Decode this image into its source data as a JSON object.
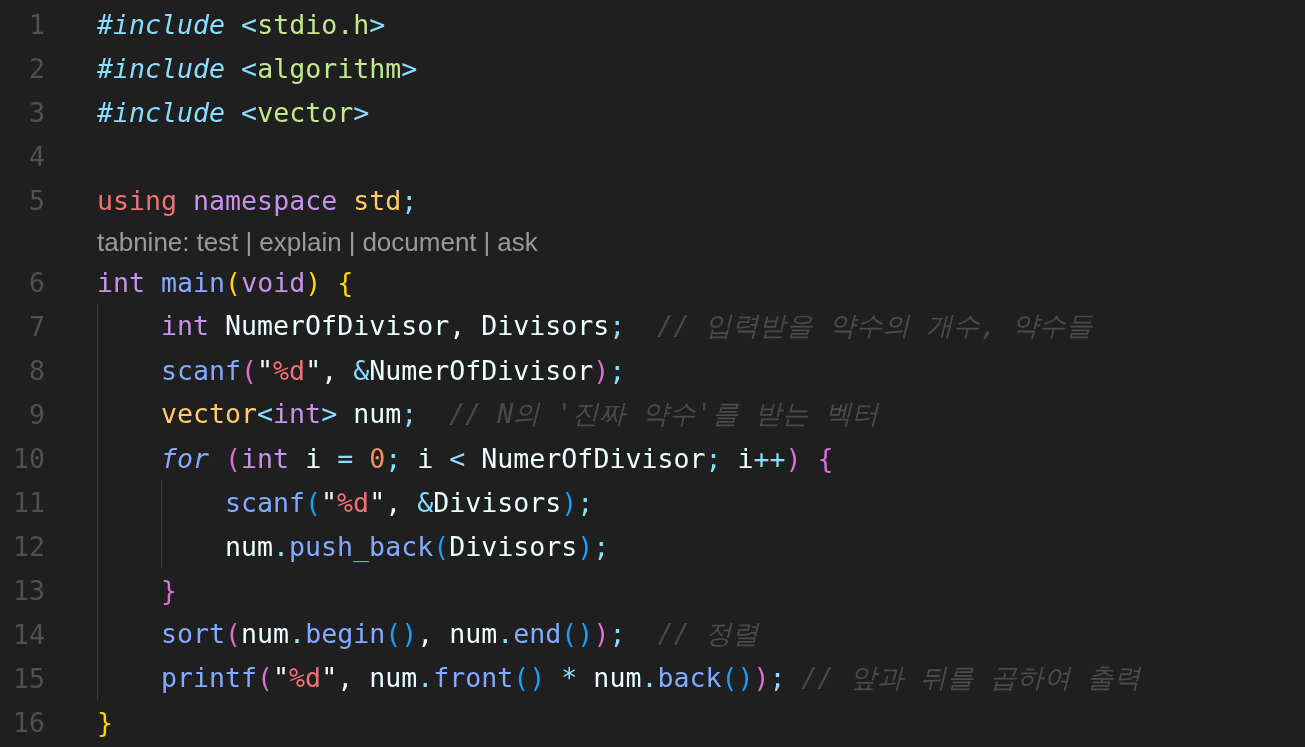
{
  "editor": {
    "lines": [
      {
        "kind": "code",
        "number": "1",
        "tokens": [
          {
            "text": "#include",
            "kind": "directive"
          },
          {
            "text": " <",
            "kind": "punct"
          },
          {
            "text": "stdio.h",
            "kind": "header"
          },
          {
            "text": ">",
            "kind": "punct"
          }
        ]
      },
      {
        "kind": "code",
        "number": "2",
        "tokens": [
          {
            "text": "#include",
            "kind": "directive"
          },
          {
            "text": " <",
            "kind": "punct"
          },
          {
            "text": "algorithm",
            "kind": "header"
          },
          {
            "text": ">",
            "kind": "punct"
          }
        ]
      },
      {
        "kind": "code",
        "number": "3",
        "tokens": [
          {
            "text": "#include",
            "kind": "directive"
          },
          {
            "text": " <",
            "kind": "punct"
          },
          {
            "text": "vector",
            "kind": "header"
          },
          {
            "text": ">",
            "kind": "punct"
          }
        ]
      },
      {
        "kind": "code",
        "number": "4"
      },
      {
        "kind": "code",
        "number": "5",
        "tokens": [
          {
            "text": "using",
            "kind": "keyword"
          },
          {
            "text": " namespace",
            "kind": "storage"
          },
          {
            "text": " std",
            "kind": "type"
          },
          {
            "text": ";",
            "kind": "punct"
          }
        ]
      },
      {
        "kind": "codelens",
        "prefix": "tabnine:",
        "separator": "|",
        "actions": [
          "test",
          "explain",
          "document",
          "ask"
        ]
      },
      {
        "kind": "code",
        "number": "6",
        "tokens": [
          {
            "text": "int",
            "kind": "storage"
          },
          {
            "text": " main",
            "kind": "function"
          },
          {
            "text": "(",
            "kind": "bracket1"
          },
          {
            "text": "void",
            "kind": "storage"
          },
          {
            "text": ")",
            "kind": "bracket1"
          },
          {
            "text": " {",
            "kind": "bracket1"
          }
        ],
        "children": [
          {
            "kind": "code",
            "number": "7",
            "tokens": [
              {
                "text": "int",
                "kind": "storage"
              },
              {
                "text": " NumerOfDivisor, Divisors",
                "kind": "plain"
              },
              {
                "text": ";",
                "kind": "punct"
              },
              {
                "text": "  // 입력받을 약수의 개수, 약수들",
                "kind": "comment"
              }
            ]
          },
          {
            "kind": "code",
            "number": "8",
            "tokens": [
              {
                "text": "scanf",
                "kind": "function"
              },
              {
                "text": "(",
                "kind": "bracket2"
              },
              {
                "text": "\"",
                "kind": "string"
              },
              {
                "text": "%d",
                "kind": "format"
              },
              {
                "text": "\"",
                "kind": "string"
              },
              {
                "text": ", ",
                "kind": "plain"
              },
              {
                "text": "&",
                "kind": "punct"
              },
              {
                "text": "NumerOfDivisor",
                "kind": "plain"
              },
              {
                "text": ")",
                "kind": "bracket2"
              },
              {
                "text": ";",
                "kind": "punct"
              }
            ]
          },
          {
            "kind": "code",
            "number": "9",
            "tokens": [
              {
                "text": "vector",
                "kind": "type"
              },
              {
                "text": "<",
                "kind": "punct"
              },
              {
                "text": "int",
                "kind": "storage"
              },
              {
                "text": ">",
                "kind": "punct"
              },
              {
                "text": " num",
                "kind": "plain"
              },
              {
                "text": ";",
                "kind": "punct"
              },
              {
                "text": "  // N의 '진짜 약수'를 받는 벡터",
                "kind": "comment"
              }
            ]
          },
          {
            "kind": "code",
            "number": "10",
            "tokens": [
              {
                "text": "for",
                "kind": "control"
              },
              {
                "text": " (",
                "kind": "bracket2"
              },
              {
                "text": "int",
                "kind": "storage"
              },
              {
                "text": " i ",
                "kind": "plain"
              },
              {
                "text": "=",
                "kind": "punct"
              },
              {
                "text": " 0",
                "kind": "number"
              },
              {
                "text": ";",
                "kind": "punct"
              },
              {
                "text": " i ",
                "kind": "plain"
              },
              {
                "text": "<",
                "kind": "punct"
              },
              {
                "text": " NumerOfDivisor",
                "kind": "plain"
              },
              {
                "text": ";",
                "kind": "punct"
              },
              {
                "text": " i",
                "kind": "plain"
              },
              {
                "text": "++",
                "kind": "punct"
              },
              {
                "text": ")",
                "kind": "bracket2"
              },
              {
                "text": " {",
                "kind": "bracket2"
              }
            ],
            "children": [
              {
                "kind": "code",
                "number": "11",
                "tokens": [
                  {
                    "text": "scanf",
                    "kind": "function"
                  },
                  {
                    "text": "(",
                    "kind": "bracket3"
                  },
                  {
                    "text": "\"",
                    "kind": "string"
                  },
                  {
                    "text": "%d",
                    "kind": "format"
                  },
                  {
                    "text": "\"",
                    "kind": "string"
                  },
                  {
                    "text": ", ",
                    "kind": "plain"
                  },
                  {
                    "text": "&",
                    "kind": "punct"
                  },
                  {
                    "text": "Divisors",
                    "kind": "plain"
                  },
                  {
                    "text": ")",
                    "kind": "bracket3"
                  },
                  {
                    "text": ";",
                    "kind": "punct"
                  }
                ]
              },
              {
                "kind": "code",
                "number": "12",
                "tokens": [
                  {
                    "text": "num",
                    "kind": "plain"
                  },
                  {
                    "text": ".",
                    "kind": "punct"
                  },
                  {
                    "text": "push_back",
                    "kind": "function"
                  },
                  {
                    "text": "(",
                    "kind": "bracket3"
                  },
                  {
                    "text": "Divisors",
                    "kind": "plain"
                  },
                  {
                    "text": ")",
                    "kind": "bracket3"
                  },
                  {
                    "text": ";",
                    "kind": "punct"
                  }
                ]
              }
            ]
          },
          {
            "kind": "code",
            "number": "13",
            "tokens": [
              {
                "text": "}",
                "kind": "bracket2"
              }
            ]
          },
          {
            "kind": "code",
            "number": "14",
            "tokens": [
              {
                "text": "sort",
                "kind": "function"
              },
              {
                "text": "(",
                "kind": "bracket2"
              },
              {
                "text": "num",
                "kind": "plain"
              },
              {
                "text": ".",
                "kind": "punct"
              },
              {
                "text": "begin",
                "kind": "function"
              },
              {
                "text": "()",
                "kind": "bracket3"
              },
              {
                "text": ", num",
                "kind": "plain"
              },
              {
                "text": ".",
                "kind": "punct"
              },
              {
                "text": "end",
                "kind": "function"
              },
              {
                "text": "()",
                "kind": "bracket3"
              },
              {
                "text": ")",
                "kind": "bracket2"
              },
              {
                "text": ";",
                "kind": "punct"
              },
              {
                "text": "  // 정렬",
                "kind": "comment"
              }
            ]
          },
          {
            "kind": "code",
            "number": "15",
            "tokens": [
              {
                "text": "printf",
                "kind": "function"
              },
              {
                "text": "(",
                "kind": "bracket2"
              },
              {
                "text": "\"",
                "kind": "string"
              },
              {
                "text": "%d",
                "kind": "format"
              },
              {
                "text": "\"",
                "kind": "string"
              },
              {
                "text": ", num",
                "kind": "plain"
              },
              {
                "text": ".",
                "kind": "punct"
              },
              {
                "text": "front",
                "kind": "function"
              },
              {
                "text": "()",
                "kind": "bracket3"
              },
              {
                "text": " *",
                "kind": "punct"
              },
              {
                "text": " num",
                "kind": "plain"
              },
              {
                "text": ".",
                "kind": "punct"
              },
              {
                "text": "back",
                "kind": "function"
              },
              {
                "text": "()",
                "kind": "bracket3"
              },
              {
                "text": ")",
                "kind": "bracket2"
              },
              {
                "text": ";",
                "kind": "punct"
              },
              {
                "text": " // 앞과 뒤를 곱하여 출력",
                "kind": "comment"
              }
            ]
          }
        ]
      },
      {
        "kind": "code",
        "number": "16",
        "tokens": [
          {
            "text": "}",
            "kind": "bracket1"
          }
        ]
      }
    ]
  }
}
